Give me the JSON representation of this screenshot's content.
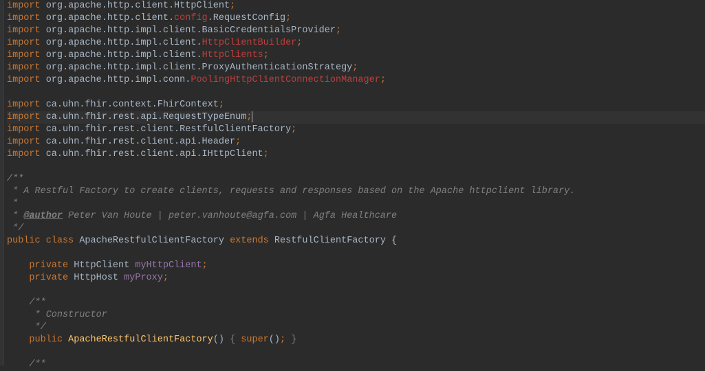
{
  "lines": [
    {
      "t": "import",
      "seg": [
        [
          "kw",
          "import"
        ],
        [
          "dim",
          " org.apache.http.client.HttpClient"
        ],
        [
          "punct",
          ";"
        ]
      ]
    },
    {
      "t": "import",
      "seg": [
        [
          "kw",
          "import"
        ],
        [
          "dim",
          " org.apache.http.client."
        ],
        [
          "unres",
          "config"
        ],
        [
          "dim",
          ".RequestConfig"
        ],
        [
          "punct",
          ";"
        ]
      ]
    },
    {
      "t": "import",
      "seg": [
        [
          "kw",
          "import"
        ],
        [
          "dim",
          " org.apache.http.impl.client.BasicCredentialsProvider"
        ],
        [
          "punct",
          ";"
        ]
      ]
    },
    {
      "t": "import",
      "seg": [
        [
          "kw",
          "import"
        ],
        [
          "dim",
          " org.apache.http.impl.client."
        ],
        [
          "unres",
          "HttpClientBuilder"
        ],
        [
          "punct",
          ";"
        ]
      ]
    },
    {
      "t": "import",
      "seg": [
        [
          "kw",
          "import"
        ],
        [
          "dim",
          " org.apache.http.impl.client."
        ],
        [
          "unres",
          "HttpClients"
        ],
        [
          "punct",
          ";"
        ]
      ]
    },
    {
      "t": "import",
      "seg": [
        [
          "kw",
          "import"
        ],
        [
          "dim",
          " org.apache.http.impl.client.ProxyAuthenticationStrategy"
        ],
        [
          "punct",
          ";"
        ]
      ]
    },
    {
      "t": "import",
      "seg": [
        [
          "kw",
          "import"
        ],
        [
          "dim",
          " org.apache.http.impl.conn."
        ],
        [
          "unres",
          "PoolingHttpClientConnectionManager"
        ],
        [
          "punct",
          ";"
        ]
      ]
    },
    {
      "t": "blank",
      "seg": [
        [
          "dim",
          ""
        ]
      ]
    },
    {
      "t": "import",
      "seg": [
        [
          "kw",
          "import"
        ],
        [
          "dim",
          " ca.uhn.fhir.context.FhirContext"
        ],
        [
          "punct",
          ";"
        ]
      ]
    },
    {
      "t": "import",
      "hl": true,
      "caret": true,
      "seg": [
        [
          "kw",
          "import"
        ],
        [
          "dim",
          " ca.uhn.fhir.rest.api.RequestTypeEnum"
        ],
        [
          "punct",
          ";"
        ]
      ]
    },
    {
      "t": "import",
      "seg": [
        [
          "kw",
          "import"
        ],
        [
          "dim",
          " ca.uhn.fhir.rest.client.RestfulClientFactory"
        ],
        [
          "punct",
          ";"
        ]
      ]
    },
    {
      "t": "import",
      "seg": [
        [
          "kw",
          "import"
        ],
        [
          "dim",
          " ca.uhn.fhir.rest.client.api.Header"
        ],
        [
          "punct",
          ";"
        ]
      ]
    },
    {
      "t": "import",
      "seg": [
        [
          "kw",
          "import"
        ],
        [
          "dim",
          " ca.uhn.fhir.rest.client.api.IHttpClient"
        ],
        [
          "punct",
          ";"
        ]
      ]
    },
    {
      "t": "blank",
      "seg": [
        [
          "dim",
          ""
        ]
      ]
    },
    {
      "t": "comment",
      "seg": [
        [
          "comment",
          "/**"
        ]
      ]
    },
    {
      "t": "comment",
      "seg": [
        [
          "comment",
          " * A Restful Factory to create clients, requests and responses based on the Apache httpclient library."
        ]
      ]
    },
    {
      "t": "comment",
      "seg": [
        [
          "comment",
          " *"
        ]
      ]
    },
    {
      "t": "author",
      "seg": [
        [
          "comment",
          " * "
        ],
        [
          "doctag",
          "@author"
        ],
        [
          "comment",
          " Peter Van Houte | peter.vanhoute@agfa.com | Agfa Healthcare"
        ]
      ]
    },
    {
      "t": "comment",
      "seg": [
        [
          "comment",
          " */"
        ]
      ]
    },
    {
      "t": "class",
      "seg": [
        [
          "kw",
          "public "
        ],
        [
          "kw",
          "class "
        ],
        [
          "classdecl",
          "ApacheRestfulClientFactory "
        ],
        [
          "kw",
          "extends "
        ],
        [
          "classdecl",
          "RestfulClientFactory "
        ],
        [
          "dim",
          "{"
        ]
      ]
    },
    {
      "t": "blank",
      "seg": [
        [
          "dim",
          ""
        ]
      ]
    },
    {
      "t": "field",
      "seg": [
        [
          "dim",
          "    "
        ],
        [
          "kw",
          "private "
        ],
        [
          "classname",
          "HttpClient "
        ],
        [
          "field",
          "myHttpClient"
        ],
        [
          "punct",
          ";"
        ]
      ]
    },
    {
      "t": "field",
      "seg": [
        [
          "dim",
          "    "
        ],
        [
          "kw",
          "private "
        ],
        [
          "classname",
          "HttpHost "
        ],
        [
          "field",
          "myProxy"
        ],
        [
          "punct",
          ";"
        ]
      ]
    },
    {
      "t": "blank",
      "seg": [
        [
          "dim",
          ""
        ]
      ]
    },
    {
      "t": "comment",
      "seg": [
        [
          "dim",
          "    "
        ],
        [
          "comment",
          "/**"
        ]
      ]
    },
    {
      "t": "comment",
      "seg": [
        [
          "dim",
          "    "
        ],
        [
          "comment",
          " * Constructor"
        ]
      ]
    },
    {
      "t": "comment",
      "seg": [
        [
          "dim",
          "    "
        ],
        [
          "comment",
          " */"
        ]
      ]
    },
    {
      "t": "ctor",
      "seg": [
        [
          "dim",
          "    "
        ],
        [
          "kw",
          "public "
        ],
        [
          "methodname",
          "ApacheRestfulClientFactory"
        ],
        [
          "dim",
          "() "
        ],
        [
          "fold",
          "{ "
        ],
        [
          "kw",
          "super"
        ],
        [
          "dim",
          "()"
        ],
        [
          "punct",
          "; "
        ],
        [
          "fold",
          "}"
        ]
      ]
    },
    {
      "t": "blank",
      "seg": [
        [
          "dim",
          ""
        ]
      ]
    },
    {
      "t": "comment",
      "seg": [
        [
          "dim",
          "    "
        ],
        [
          "comment",
          "/**"
        ]
      ]
    }
  ],
  "fold_markers": [
    14,
    19,
    24,
    27
  ]
}
